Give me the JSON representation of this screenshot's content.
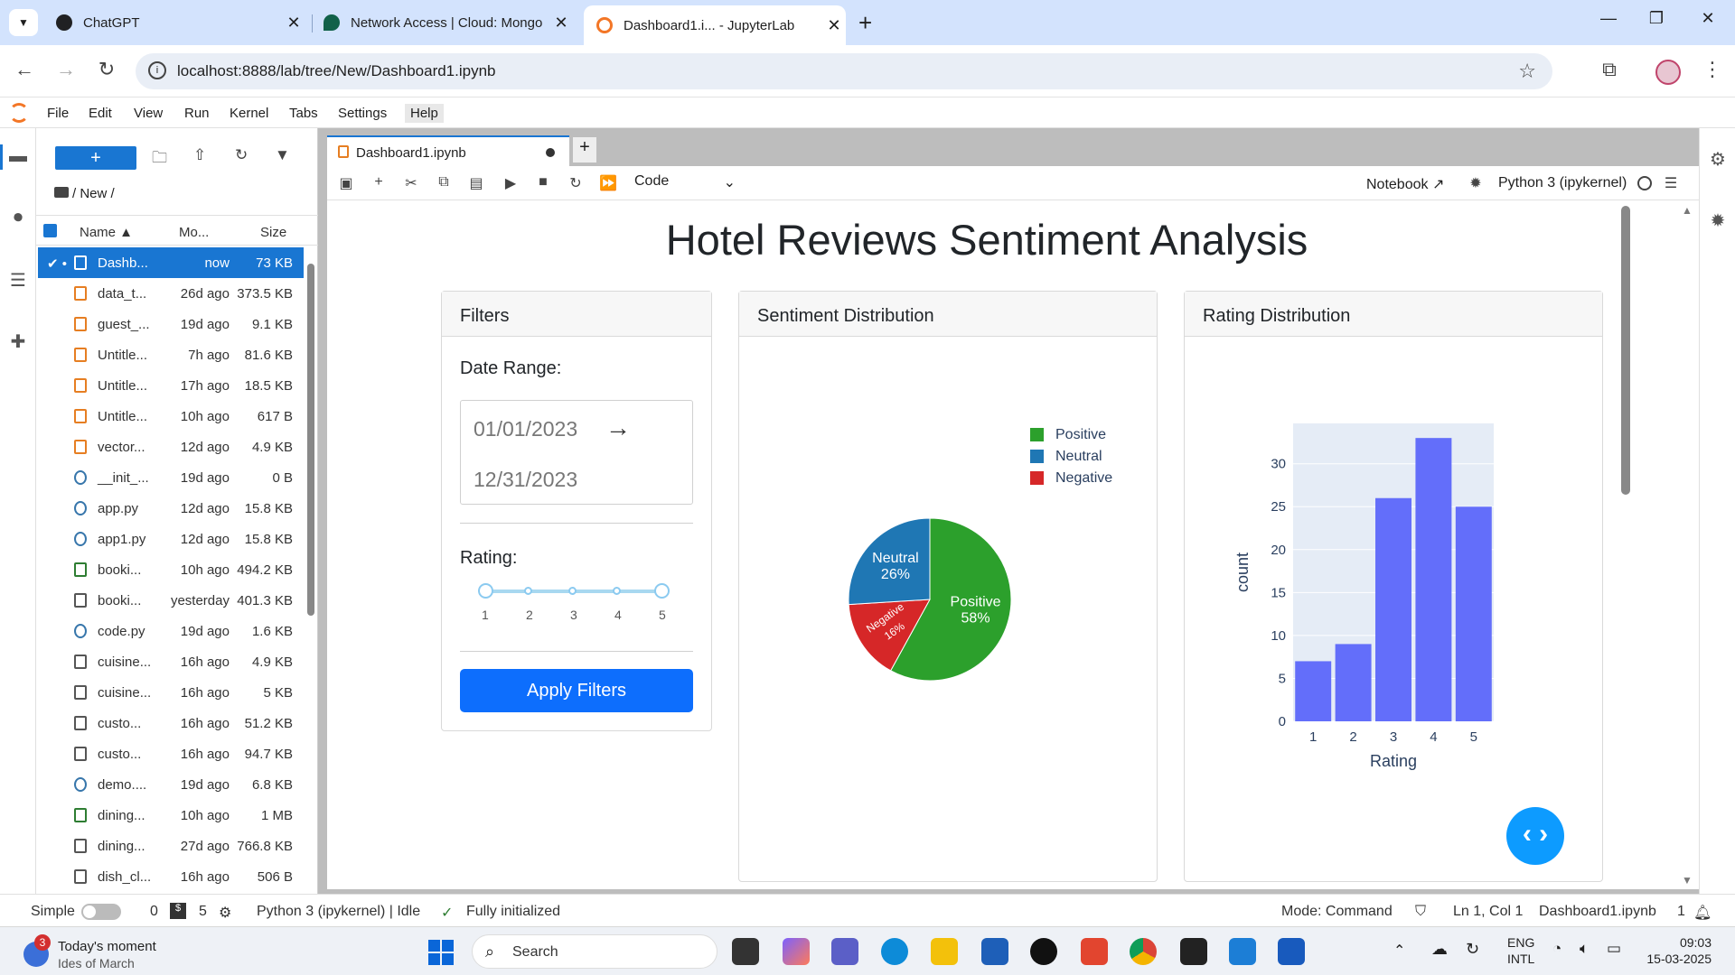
{
  "browser": {
    "tabs": [
      {
        "label": "ChatGPT",
        "color": "#202123"
      },
      {
        "label": "Network Access | Cloud: Mongo",
        "color": "#116149"
      },
      {
        "label": "Dashboard1.i... - JupyterLab",
        "color": "#f37626"
      }
    ],
    "new_tab": "+",
    "url": "localhost:8888/lab/tree/New/Dashboard1.ipynb"
  },
  "menubar": [
    "File",
    "Edit",
    "View",
    "Run",
    "Kernel",
    "Tabs",
    "Settings",
    "Help"
  ],
  "filebrowser": {
    "new_button": "+",
    "breadcrumb": "/ New /",
    "columns": {
      "name": "Name",
      "modified": "Mo...",
      "size": "Size"
    },
    "files": [
      {
        "name": "Dashb...",
        "modified": "now",
        "size": "73 KB",
        "type": "notebook",
        "selected": true
      },
      {
        "name": "data_t...",
        "modified": "26d ago",
        "size": "373.5 KB",
        "type": "notebook"
      },
      {
        "name": "guest_...",
        "modified": "19d ago",
        "size": "9.1 KB",
        "type": "notebook"
      },
      {
        "name": "Untitle...",
        "modified": "7h ago",
        "size": "81.6 KB",
        "type": "notebook"
      },
      {
        "name": "Untitle...",
        "modified": "17h ago",
        "size": "18.5 KB",
        "type": "notebook"
      },
      {
        "name": "Untitle...",
        "modified": "10h ago",
        "size": "617 B",
        "type": "notebook"
      },
      {
        "name": "vector...",
        "modified": "12d ago",
        "size": "4.9 KB",
        "type": "notebook"
      },
      {
        "name": "__init_...",
        "modified": "19d ago",
        "size": "0 B",
        "type": "python"
      },
      {
        "name": "app.py",
        "modified": "12d ago",
        "size": "15.8 KB",
        "type": "python"
      },
      {
        "name": "app1.py",
        "modified": "12d ago",
        "size": "15.8 KB",
        "type": "python"
      },
      {
        "name": "booki...",
        "modified": "10h ago",
        "size": "494.2 KB",
        "type": "csv"
      },
      {
        "name": "booki...",
        "modified": "yesterday",
        "size": "401.3 KB",
        "type": "file"
      },
      {
        "name": "code.py",
        "modified": "19d ago",
        "size": "1.6 KB",
        "type": "python"
      },
      {
        "name": "cuisine...",
        "modified": "16h ago",
        "size": "4.9 KB",
        "type": "file"
      },
      {
        "name": "cuisine...",
        "modified": "16h ago",
        "size": "5 KB",
        "type": "file"
      },
      {
        "name": "custo...",
        "modified": "16h ago",
        "size": "51.2 KB",
        "type": "file"
      },
      {
        "name": "custo...",
        "modified": "16h ago",
        "size": "94.7 KB",
        "type": "file"
      },
      {
        "name": "demo....",
        "modified": "19d ago",
        "size": "6.8 KB",
        "type": "python"
      },
      {
        "name": "dining...",
        "modified": "10h ago",
        "size": "1 MB",
        "type": "csv"
      },
      {
        "name": "dining...",
        "modified": "27d ago",
        "size": "766.8 KB",
        "type": "file"
      },
      {
        "name": "dish_cl...",
        "modified": "16h ago",
        "size": "506 B",
        "type": "file"
      }
    ]
  },
  "notebook": {
    "tab_label": "Dashboard1.ipynb",
    "cell_type": "Code",
    "notebook_link": "Notebook",
    "kernel": "Python 3 (ipykernel)"
  },
  "dashboard": {
    "title": "Hotel Reviews Sentiment Analysis",
    "filters": {
      "header": "Filters",
      "date_label": "Date Range:",
      "start_date": "01/01/2023",
      "arrow": "→",
      "end_date": "12/31/2023",
      "rating_label": "Rating:",
      "slider_ticks": [
        "1",
        "2",
        "3",
        "4",
        "5"
      ],
      "slider_range": [
        1,
        5
      ],
      "apply_button": "Apply Filters"
    },
    "sentiment_header": "Sentiment Distribution",
    "rating_header": "Rating Distribution"
  },
  "chart_data": [
    {
      "type": "pie",
      "labels": [
        "Positive",
        "Neutral",
        "Negative"
      ],
      "values": [
        58,
        26,
        16
      ],
      "slice_labels": [
        "Positive\n58%",
        "Neutral\n26%",
        "Negative\n16%"
      ],
      "colors": [
        "#2ca02c",
        "#1f77b4",
        "#d62728"
      ],
      "legend": "top-right"
    },
    {
      "type": "bar",
      "categories": [
        "1",
        "2",
        "3",
        "4",
        "5"
      ],
      "values": [
        7,
        9,
        26,
        33,
        25
      ],
      "xlabel": "Rating",
      "ylabel": "count",
      "yticks": [
        0,
        5,
        10,
        15,
        20,
        25,
        30
      ],
      "ylim": [
        0,
        34.7
      ],
      "color": "#636efa",
      "grid": true
    }
  ],
  "statusbar": {
    "mode_label": "Simple",
    "terminals": "0",
    "kernels": "5",
    "kernel_status": "Python 3 (ipykernel) | Idle",
    "init_status": "Fully initialized",
    "mode": "Mode: Command",
    "position": "Ln 1, Col 1",
    "filename": "Dashboard1.ipynb",
    "notifications": "1"
  },
  "taskbar": {
    "news_badge": "3",
    "news_title": "Today's moment",
    "news_sub": "Ides of March",
    "search": "Search",
    "lang": "ENG",
    "layout": "INTL",
    "time": "09:03",
    "date": "15-03-2025"
  }
}
